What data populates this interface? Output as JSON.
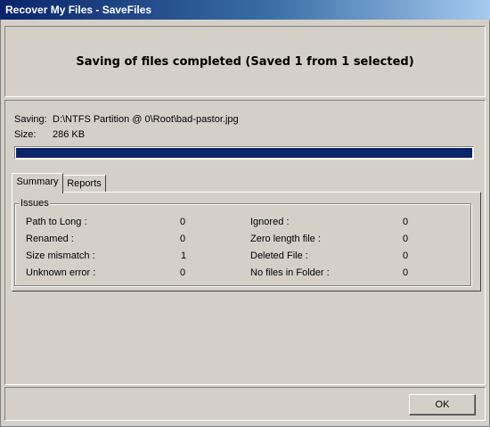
{
  "window": {
    "title": "Recover My Files - SaveFiles"
  },
  "header": {
    "message": "Saving of files completed (Saved 1 from 1 selected)"
  },
  "saving": {
    "label": "Saving:",
    "value": "D:\\NTFS Partition @ 0\\Root\\bad-pastor.jpg"
  },
  "size": {
    "label": "Size:",
    "value": "286 KB"
  },
  "progress": {
    "fraction": 1.0,
    "color": "#0a246a"
  },
  "tabs": [
    {
      "label": "Summary",
      "active": true
    },
    {
      "label": "Reports",
      "active": false
    }
  ],
  "issues": {
    "legend": "Issues",
    "left": [
      {
        "label": "Path to Long :",
        "value": "0"
      },
      {
        "label": "Renamed :",
        "value": "0"
      },
      {
        "label": "Size mismatch :",
        "value": "1"
      },
      {
        "label": "Unknown error :",
        "value": "0"
      }
    ],
    "right": [
      {
        "label": "Ignored :",
        "value": "0"
      },
      {
        "label": "Zero length file :",
        "value": "0"
      },
      {
        "label": "Deleted File :",
        "value": "0"
      },
      {
        "label": "No files in Folder :",
        "value": "0"
      }
    ]
  },
  "footer": {
    "ok_label": "OK"
  }
}
